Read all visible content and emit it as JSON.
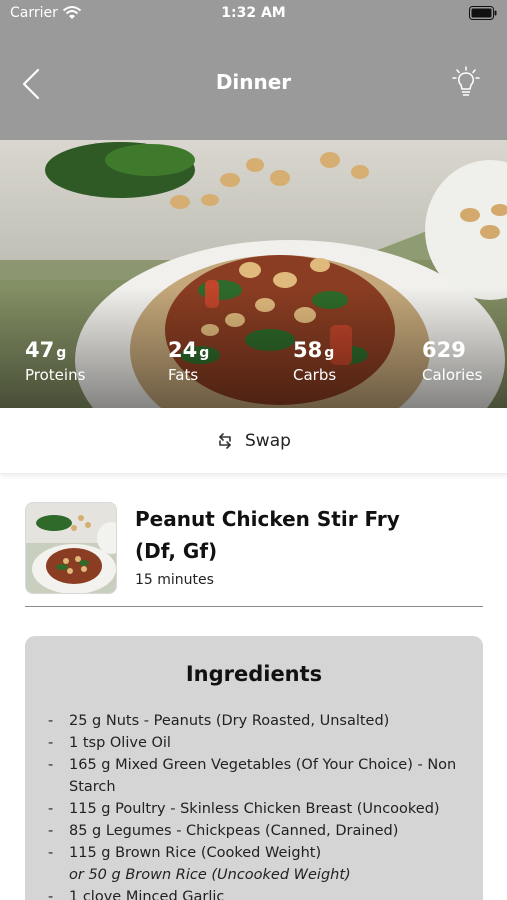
{
  "status_bar": {
    "carrier": "Carrier",
    "time": "1:32 AM"
  },
  "nav": {
    "title": "Dinner",
    "back_icon": "chevron-left-icon",
    "tip_icon": "lightbulb-icon"
  },
  "macros": [
    {
      "value": "47",
      "unit": "g",
      "label": "Proteins"
    },
    {
      "value": "24",
      "unit": "g",
      "label": "Fats"
    },
    {
      "value": "58",
      "unit": "g",
      "label": "Carbs"
    },
    {
      "value": "629",
      "unit": "",
      "label": "Calories"
    }
  ],
  "swap": {
    "label": "Swap",
    "icon": "swap-icon"
  },
  "recipe": {
    "name": "Peanut Chicken Stir Fry (Df, Gf)",
    "duration": "15 minutes"
  },
  "ingredients": {
    "title": "Ingredients",
    "items": [
      {
        "text": "25 g Nuts - Peanuts (Dry Roasted, Unsalted)",
        "alt": ""
      },
      {
        "text": "1 tsp Olive Oil",
        "alt": ""
      },
      {
        "text": "165 g Mixed Green Vegetables (Of Your Choice) - Non Starch",
        "alt": ""
      },
      {
        "text": "115 g Poultry - Skinless Chicken Breast (Uncooked)",
        "alt": ""
      },
      {
        "text": "85 g Legumes - Chickpeas (Canned, Drained)",
        "alt": ""
      },
      {
        "text": "115 g Brown Rice (Cooked Weight)",
        "alt": "or 50 g Brown Rice (Uncooked Weight)"
      },
      {
        "text": "1 clove Minced Garlic",
        "alt": ""
      }
    ]
  },
  "colors": {
    "header_bg": "#9a9a9a",
    "card_bg": "#d5d5d5",
    "text": "#111111"
  }
}
